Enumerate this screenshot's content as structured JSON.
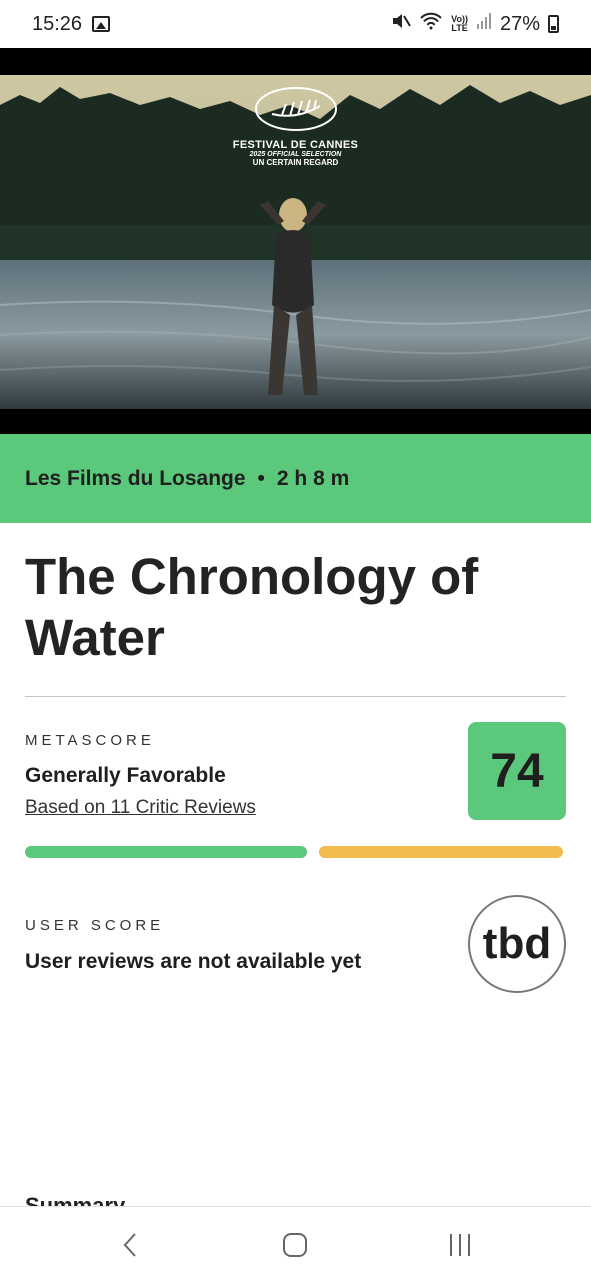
{
  "status_bar": {
    "time": "15:26",
    "battery": "27%",
    "network": "LTE",
    "volte": "Vo))"
  },
  "hero": {
    "festival_name": "FESTIVAL DE CANNES",
    "festival_selection": "2025 OFFICIAL SELECTION",
    "festival_section": "UN CERTAIN REGARD"
  },
  "info_bar": {
    "distributor": "Les Films du Losange",
    "separator": "•",
    "runtime": "2 h 8 m",
    "color": "#5cc87c"
  },
  "title": "The Chronology of Water",
  "metascore": {
    "label": "METASCORE",
    "description": "Generally Favorable",
    "link": "Based on 11 Critic Reviews",
    "score": "74",
    "positive_fraction": 0.535,
    "mixed_fraction": 0.445,
    "positive_color": "#5cc87c",
    "mixed_color": "#f1bb4e"
  },
  "user_score": {
    "label": "USER SCORE",
    "description": "User reviews are not available yet",
    "score": "tbd"
  },
  "summary_heading": "Summary",
  "icons": {
    "status_left": [
      "gallery-icon"
    ],
    "status_right": [
      "mute-icon",
      "wifi-icon",
      "signal-icon",
      "battery-icon"
    ],
    "nav": [
      "back-icon",
      "home-icon",
      "recent-apps-icon"
    ]
  }
}
